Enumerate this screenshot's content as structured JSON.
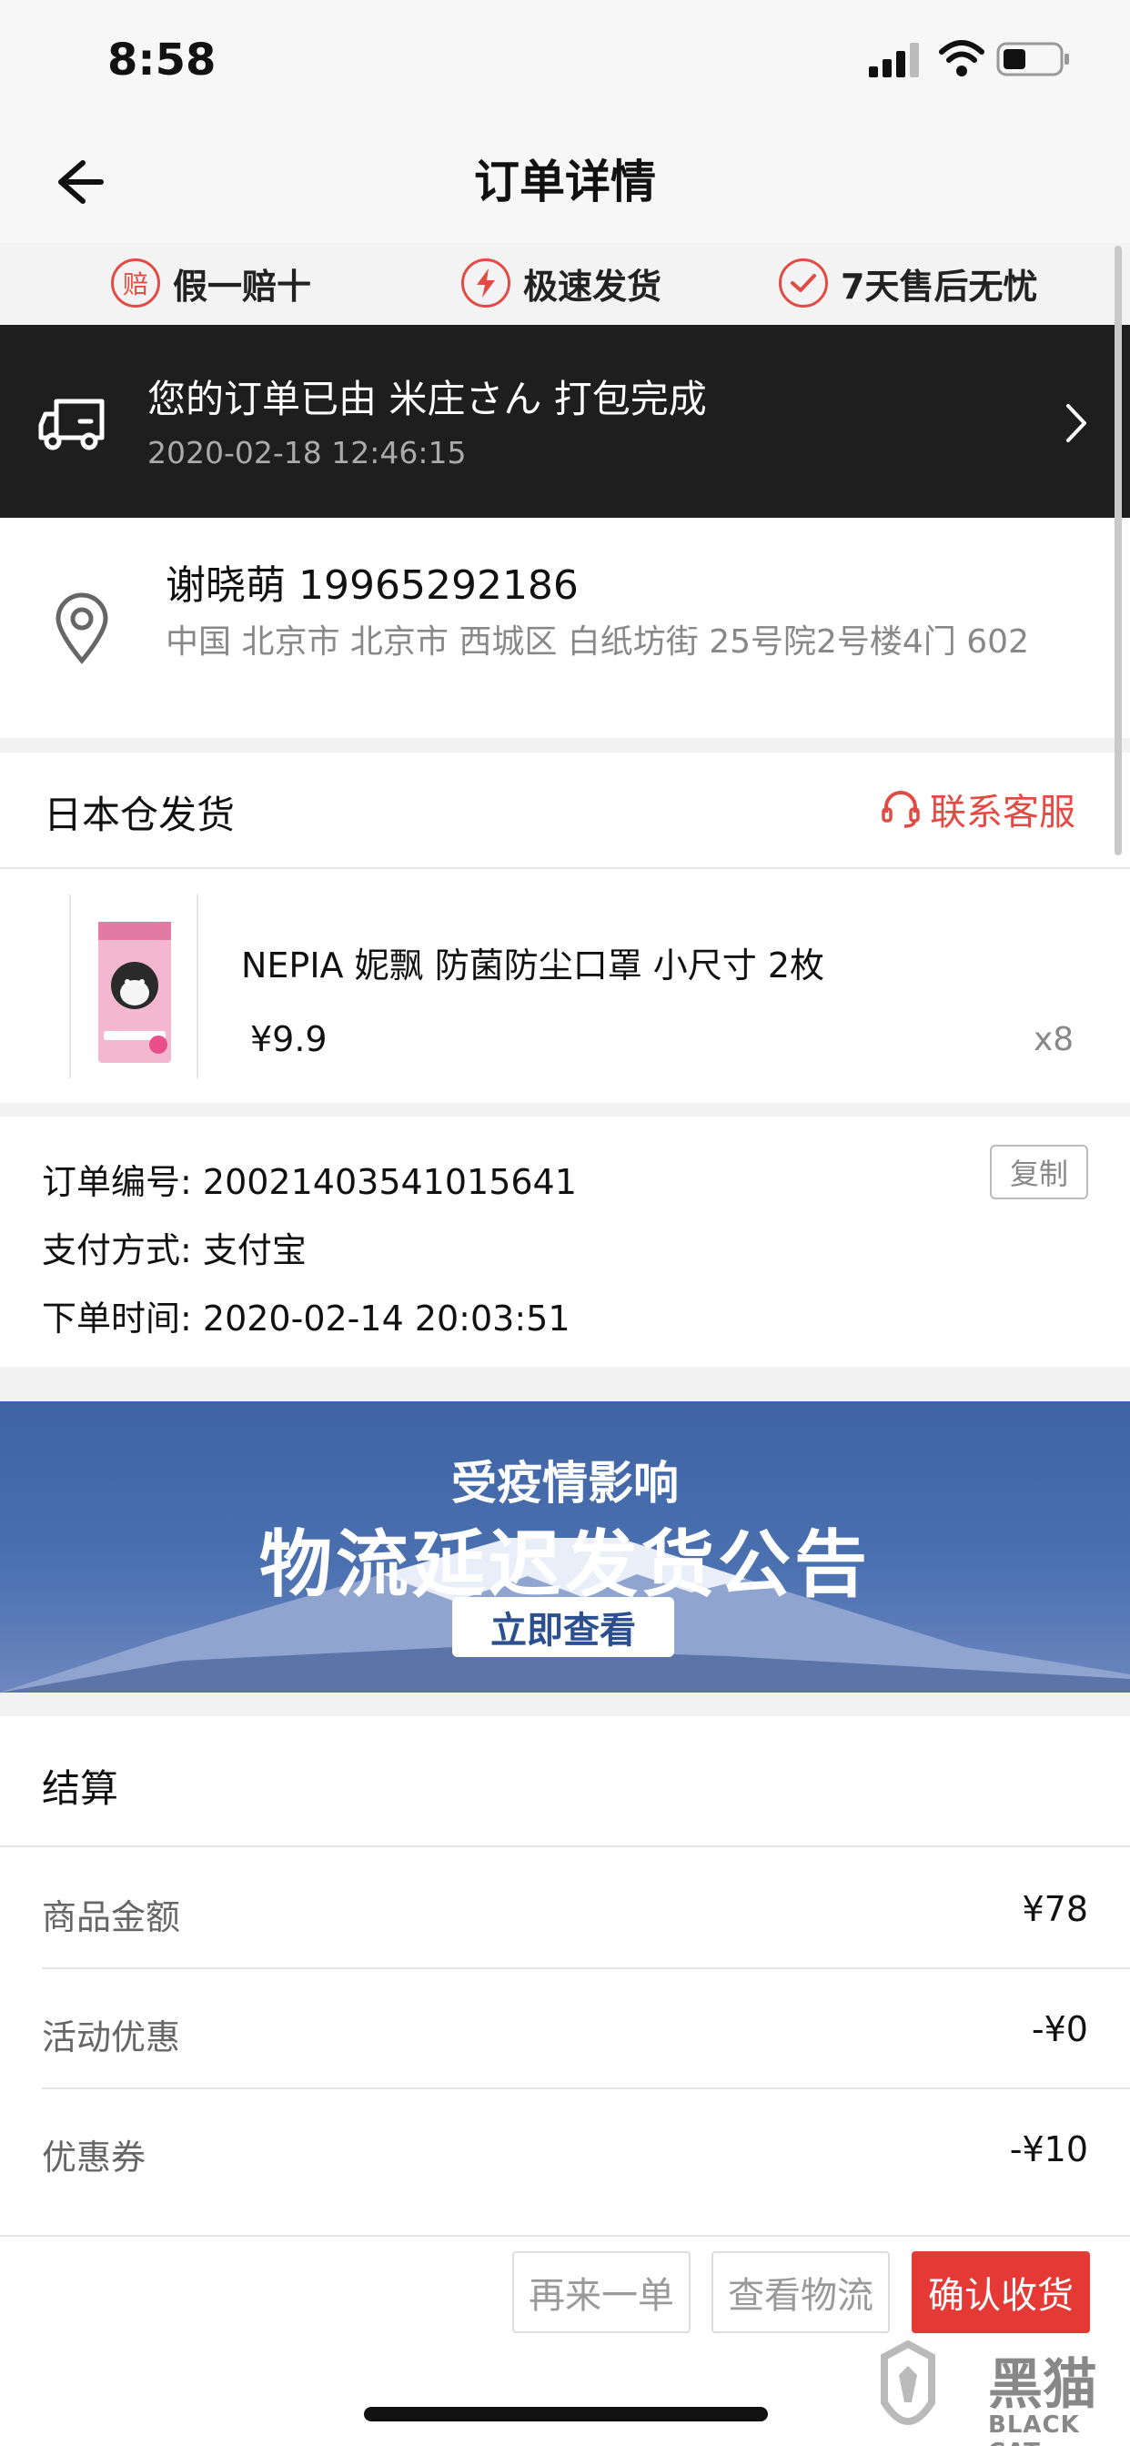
{
  "status_bar": {
    "time": "8:58"
  },
  "nav": {
    "title": "订单详情"
  },
  "guarantees": [
    {
      "icon": "compensation-icon",
      "icon_char": "赔",
      "label": "假一赔十"
    },
    {
      "icon": "lightning-icon",
      "label": "极速发货"
    },
    {
      "icon": "check-circle-icon",
      "label": "7天售后无忧"
    }
  ],
  "package": {
    "message": "您的订单已由 米庄さん 打包完成",
    "time": "2020-02-18 12:46:15"
  },
  "address": {
    "name_phone": "谢晓萌 19965292186",
    "line": "中国 北京市 北京市 西城区 白纸坊街 25号院2号楼4门 602"
  },
  "store": {
    "name": "日本仓发货",
    "service_label": "联系客服"
  },
  "product": {
    "name": "NEPIA 妮飘 防菌防尘口罩 小尺寸 2枚",
    "price": "¥9.9",
    "qty": "x8"
  },
  "order_info": {
    "number_label": "订单编号:",
    "number_value": "20021403541015641",
    "copy_label": "复制",
    "payment_label": "支付方式:",
    "payment_value": "支付宝",
    "time_label": "下单时间:",
    "time_value": "2020-02-14 20:03:51"
  },
  "promo_banner": {
    "line1": "受疫情影响",
    "line2": "物流延迟发货公告",
    "button": "立即查看"
  },
  "settlement": {
    "title": "结算",
    "rows": [
      {
        "label": "商品金额",
        "value": "¥78"
      },
      {
        "label": "活动优惠",
        "value": "-¥0"
      },
      {
        "label": "优惠券",
        "value": "-¥10"
      }
    ]
  },
  "actions": {
    "reorder": "再来一单",
    "logistics": "查看物流",
    "confirm": "确认收货"
  },
  "watermark": {
    "cn": "黑猫",
    "en": "BLACK CAT"
  },
  "colors": {
    "accent": "#e53935",
    "dark_banner": "#1e1e1e",
    "promo_blue": "#4a70b0"
  }
}
